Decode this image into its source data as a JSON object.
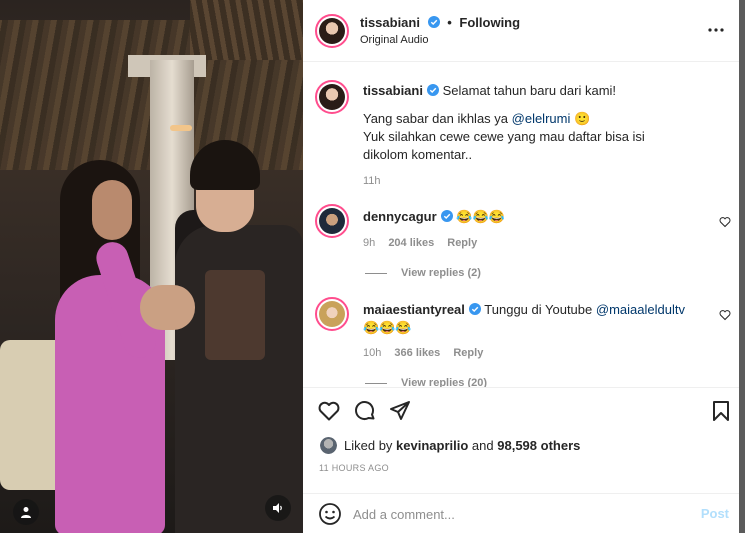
{
  "colors": {
    "verified": "#3897f0",
    "muted": "#8e8e8e",
    "mention": "#00376b",
    "post_disabled": "#b2dffc",
    "story_ring": "#ff4d8d",
    "dress": "#c85fb4"
  },
  "video": {
    "user_tag_icon": "user-icon",
    "mute_icon": "speaker-icon"
  },
  "header": {
    "username": "tissabiani",
    "separator": "•",
    "follow_status": "Following",
    "audio_label": "Original Audio",
    "more_icon": "more-horizontal-icon"
  },
  "caption": {
    "username": "tissabiani",
    "line1": "Selamat tahun baru dari kami!",
    "line2_prefix": "Yang sabar dan ikhlas ya ",
    "line2_mention": "@elelrumi",
    "line2_emoji": "🙂",
    "line3": "Yuk silahkan cewe cewe yang mau daftar bisa isi dikolom komentar..",
    "time": "11h"
  },
  "comments": [
    {
      "username": "dennycagur",
      "text": "😂😂😂",
      "time": "9h",
      "likes": "204 likes",
      "reply": "Reply",
      "view_replies": "View replies (2)"
    },
    {
      "username": "maiaestiantyreal",
      "text_prefix": "Tunggu di Youtube ",
      "mention": "@maiaaleldultv",
      "text_suffix": "😂😂😂",
      "time": "10h",
      "likes": "366 likes",
      "reply": "Reply",
      "view_replies": "View replies (20)"
    }
  ],
  "actions": {
    "like_icon": "heart-icon",
    "comment_icon": "comment-icon",
    "share_icon": "share-icon",
    "save_icon": "bookmark-icon"
  },
  "likes": {
    "prefix": "Liked by ",
    "user": "kevinaprilio",
    "middle": " and ",
    "count": "98,598 others"
  },
  "post_time": "11 HOURS AGO",
  "add_comment": {
    "placeholder": "Add a comment...",
    "post_label": "Post",
    "emoji_icon": "smile-icon"
  }
}
